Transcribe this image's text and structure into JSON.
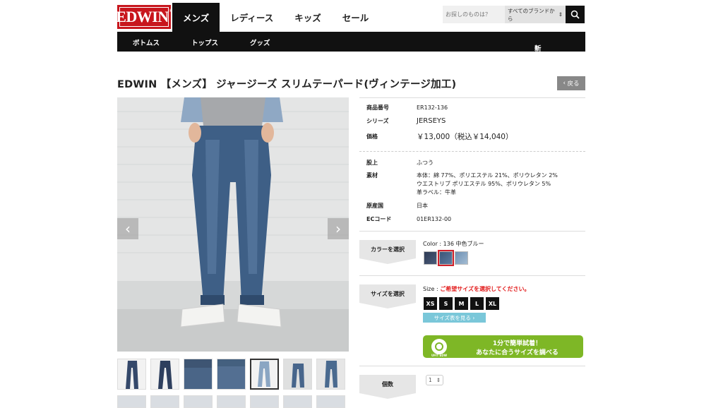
{
  "header": {
    "logo_text": "EDWIN",
    "tabs": [
      {
        "label": "メンズ",
        "active": true
      },
      {
        "label": "レディース",
        "active": false
      },
      {
        "label": "キッズ",
        "active": false
      },
      {
        "label": "セール",
        "active": false
      }
    ],
    "search_placeholder": "お探しのものは？",
    "brand_select": "すべてのブランドから"
  },
  "subnav": {
    "items": [
      "ボトムス",
      "トップス",
      "グッズ"
    ],
    "new_arrivals": "新着一覧"
  },
  "product": {
    "title": "EDWIN 【メンズ】 ジャージーズ スリムテーパード(ヴィンテージ加工)",
    "back_label": "戻る",
    "specs_top": [
      {
        "key": "商品番号",
        "value": "ER132-136"
      },
      {
        "key": "シリーズ",
        "value": "JERSEYS"
      },
      {
        "key": "価格",
        "value": "￥13,000（税込￥14,040）"
      }
    ],
    "specs": [
      {
        "key": "股上",
        "value": "ふつう"
      },
      {
        "key": "素材",
        "value_lines": [
          "本体：綿 77%、ポリエステル 21%、ポリウレタン 2%",
          "ウエストリブ ポリエステル 95%、ポリウレタン 5%",
          "革ラベル：牛革"
        ]
      },
      {
        "key": "原産国",
        "value": "日本"
      },
      {
        "key": "ECコード",
        "value": "01ER132-00"
      }
    ],
    "color": {
      "label": "カラーを選択",
      "caption": "Color : 136 中色ブルー",
      "swatches": [
        {
          "name": "dark",
          "color": "#3d4a66",
          "selected": false
        },
        {
          "name": "mid",
          "color": "#4c6585",
          "selected": true
        },
        {
          "name": "light",
          "color": "#8aa9c4",
          "selected": false
        }
      ]
    },
    "size": {
      "label": "サイズを選択",
      "caption_prefix": "Size : ",
      "caption_warning": "ご希望サイズを選択してください。",
      "options": [
        "XS",
        "S",
        "M",
        "L",
        "XL"
      ],
      "guide_label": "サイズ表を見る"
    },
    "fit_banner": {
      "line1": "1分で簡単試着！",
      "line2": "あなたに合うサイズを調べる",
      "badge": "UFIT EDW"
    },
    "quantity": {
      "label": "個数",
      "value": "1"
    }
  },
  "gallery": {
    "arrow_prev": "‹",
    "arrow_next": "›"
  },
  "colors": {
    "brand_red": "#c8161d",
    "accent_green": "#7eb726",
    "accent_cyan": "#7ac7d9",
    "warning_red": "#e21a1a"
  }
}
